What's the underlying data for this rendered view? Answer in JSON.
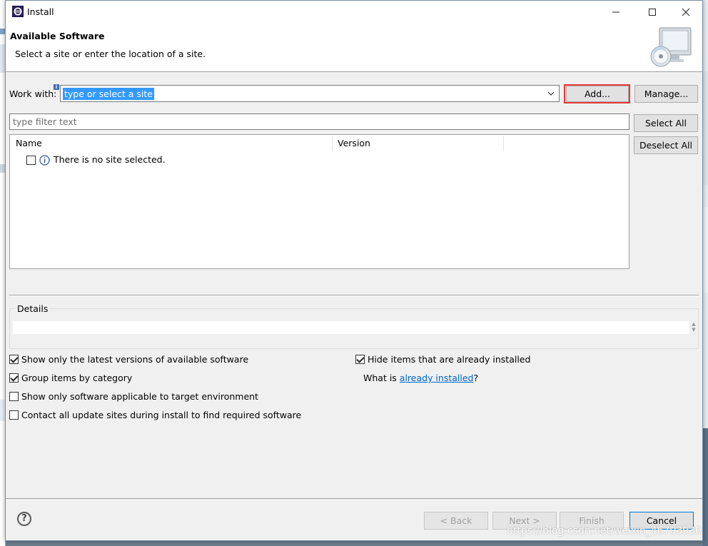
{
  "window": {
    "title": "Install"
  },
  "header": {
    "title": "Available Software",
    "description": "Select a site or enter the location of a site."
  },
  "work_with": {
    "label": "Work with:",
    "value": "type or select a site",
    "add_button": "Add...",
    "manage_button": "Manage..."
  },
  "filter": {
    "placeholder": "type filter text"
  },
  "side_buttons": {
    "select_all": "Select All",
    "deselect_all": "Deselect All"
  },
  "table": {
    "columns": [
      "Name",
      "Version"
    ],
    "rows": [
      {
        "name": "There is no site selected.",
        "checked": false
      }
    ]
  },
  "details": {
    "title": "Details"
  },
  "options": {
    "latest_versions": {
      "label": "Show only the latest versions of available software",
      "checked": true
    },
    "group_by_category": {
      "label": "Group items by category",
      "checked": true
    },
    "target_environment": {
      "label": "Show only software applicable to target environment",
      "checked": false
    },
    "contact_update_sites": {
      "label": "Contact all update sites during install to find required software",
      "checked": false
    },
    "hide_installed": {
      "label": "Hide items that are already installed",
      "checked": true
    }
  },
  "already_installed": {
    "prefix": "What is ",
    "link": "already installed",
    "suffix": "?"
  },
  "footer": {
    "back": "< Back",
    "next": "Next >",
    "finish": "Finish",
    "cancel": "Cancel"
  },
  "watermark": "https://blog.csdn.net/weixin_46703930",
  "colors": {
    "selection": "#3399ff",
    "highlight_border": "#e53935",
    "link": "#0066cc"
  }
}
